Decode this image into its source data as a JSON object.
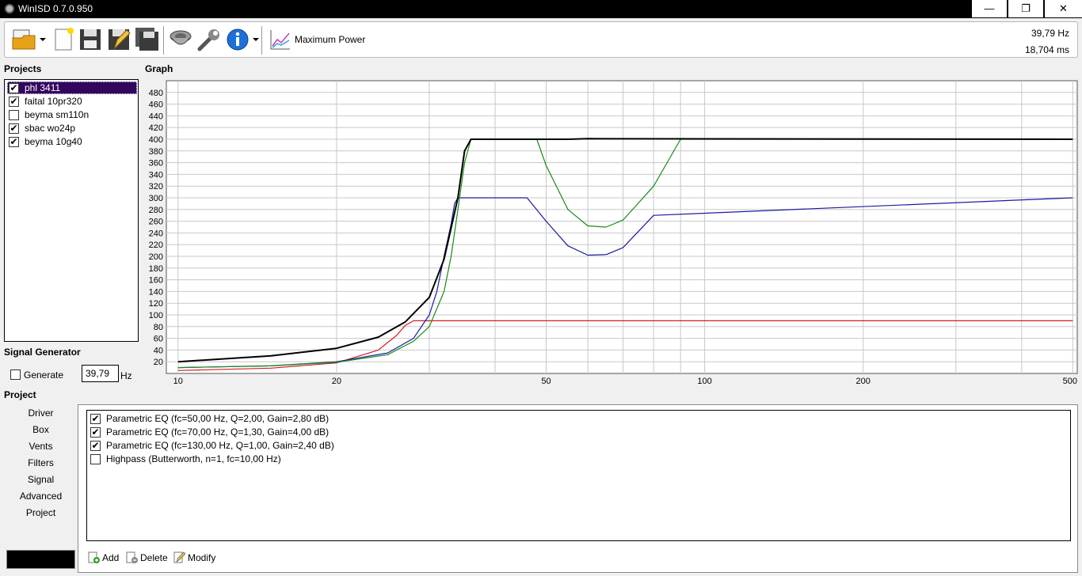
{
  "window": {
    "title": "WinISD 0.7.0.950",
    "minimize": "—",
    "restore": "❐",
    "close": "✕"
  },
  "toolbar": {
    "mode_label": "Maximum Power",
    "readout_frequency": "39,79 Hz",
    "readout_time": "18,704 ms"
  },
  "projects": {
    "label": "Projects",
    "items": [
      {
        "name": "phl 3411",
        "checked": true,
        "selected": true
      },
      {
        "name": "faital 10pr320",
        "checked": true,
        "selected": false
      },
      {
        "name": "beyma sm110n",
        "checked": false,
        "selected": false
      },
      {
        "name": "sbac wo24p",
        "checked": true,
        "selected": false
      },
      {
        "name": "beyma 10g40",
        "checked": true,
        "selected": false
      }
    ]
  },
  "graph": {
    "label": "Graph"
  },
  "signal_generator": {
    "label": "Signal Generator",
    "generate_label": "Generate",
    "generate_checked": false,
    "frequency_value": "39,79",
    "unit": "Hz"
  },
  "project_nav": {
    "label": "Project",
    "items": [
      "Driver",
      "Box",
      "Vents",
      "Filters",
      "Signal",
      "Advanced",
      "Project"
    ]
  },
  "filters": {
    "items": [
      {
        "label": "Parametric EQ (fc=50,00 Hz, Q=2,00, Gain=2,80 dB)",
        "checked": true
      },
      {
        "label": "Parametric EQ (fc=70,00 Hz, Q=1,30, Gain=4,00 dB)",
        "checked": true
      },
      {
        "label": "Parametric EQ (fc=130,00 Hz, Q=1,00, Gain=2,40 dB)",
        "checked": true
      },
      {
        "label": "Highpass (Butterworth, n=1, fc=10,00 Hz)",
        "checked": false
      }
    ],
    "add_label": "Add",
    "delete_label": "Delete",
    "modify_label": "Modify"
  },
  "chart_data": {
    "type": "line",
    "x_scale": "log",
    "xlim": [
      9.5,
      510
    ],
    "ylim": [
      0,
      500
    ],
    "x_ticks": [
      10,
      20,
      50,
      100,
      200,
      500
    ],
    "y_ticks": [
      20,
      40,
      60,
      80,
      100,
      120,
      140,
      160,
      180,
      200,
      220,
      240,
      260,
      280,
      300,
      320,
      340,
      360,
      380,
      400,
      420,
      440,
      460,
      480
    ],
    "grid": true,
    "series": [
      {
        "color": "#d02020",
        "x": [
          10,
          15,
          20,
          24,
          26,
          27,
          28,
          500
        ],
        "y": [
          5,
          9,
          18,
          40,
          65,
          82,
          90,
          90
        ]
      },
      {
        "color": "#1a1aa0",
        "x": [
          10,
          15,
          20,
          25,
          28,
          30,
          31,
          32,
          33,
          33.5,
          34,
          46,
          50,
          55,
          60,
          65,
          70,
          80,
          500
        ],
        "y": [
          10,
          13,
          20,
          35,
          60,
          100,
          140,
          200,
          255,
          290,
          300,
          300,
          260,
          218,
          202,
          203,
          215,
          270,
          300
        ]
      },
      {
        "color": "#1a8a1a",
        "x": [
          10,
          15,
          20,
          25,
          28,
          30,
          32,
          33,
          34,
          35,
          36,
          48,
          50,
          55,
          60,
          65,
          70,
          80,
          90,
          500
        ],
        "y": [
          10,
          13,
          19,
          32,
          55,
          80,
          140,
          200,
          280,
          360,
          400,
          400,
          355,
          280,
          252,
          250,
          262,
          320,
          400,
          400
        ]
      },
      {
        "color": "#000000",
        "x": [
          10,
          15,
          20,
          24,
          27,
          30,
          32,
          34,
          35,
          36,
          55,
          60,
          500
        ],
        "y": [
          20,
          30,
          43,
          62,
          88,
          130,
          195,
          300,
          380,
          400,
          400,
          401,
          400
        ]
      }
    ]
  }
}
